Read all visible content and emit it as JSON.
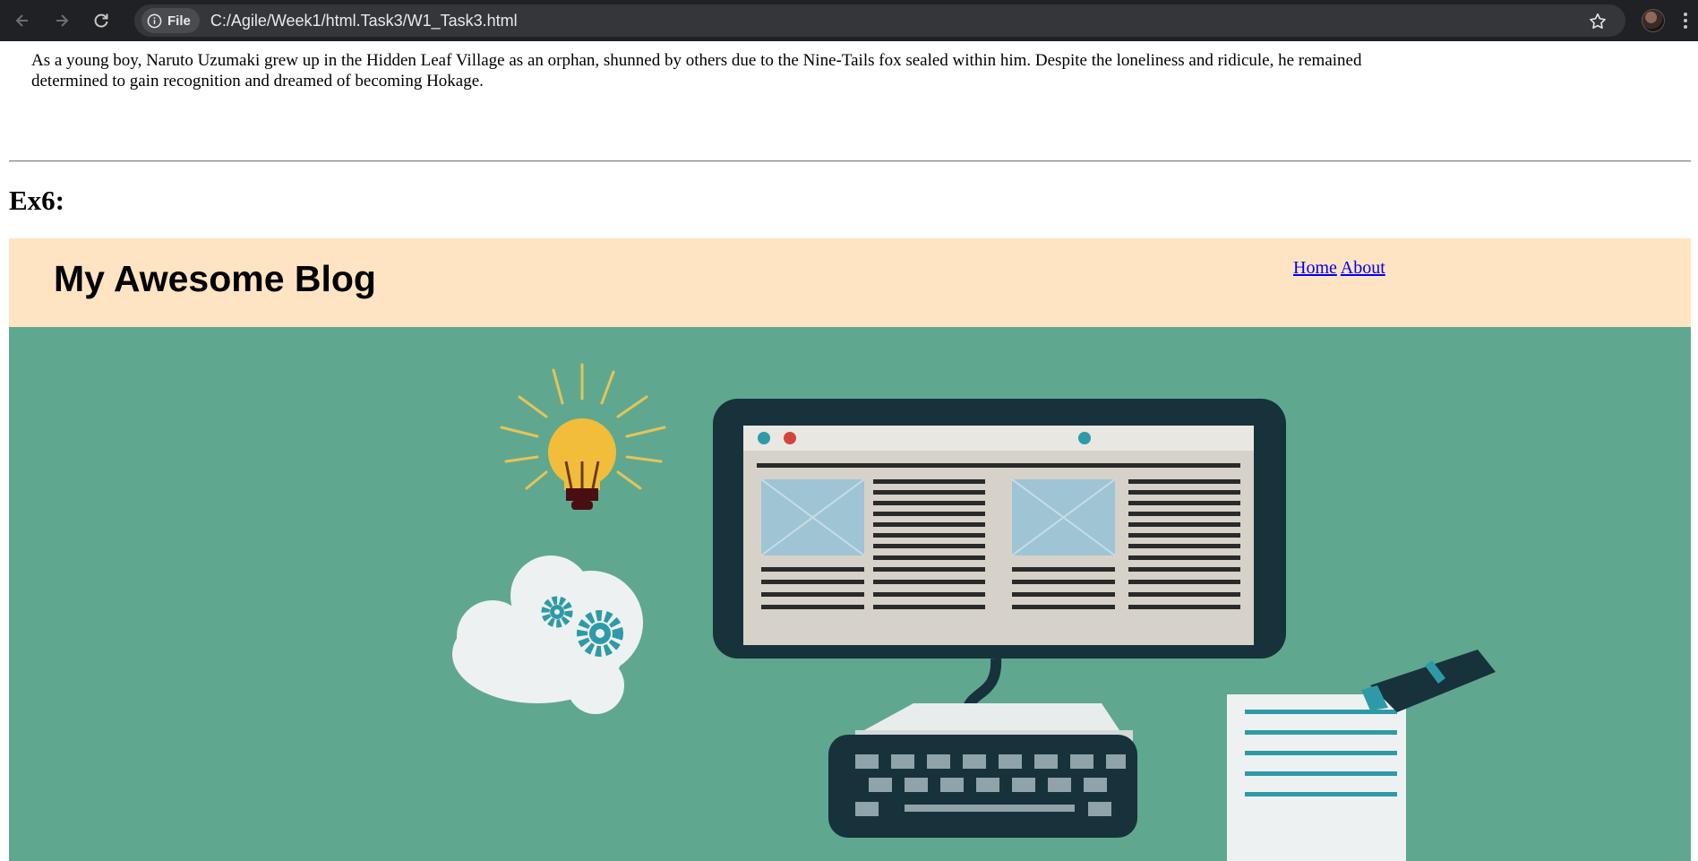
{
  "browser": {
    "url": "C:/Agile/Week1/html.Task3/W1_Task3.html",
    "site_chip_label": "File",
    "icons": [
      "back-arrow-icon",
      "forward-arrow-icon",
      "reload-icon",
      "info-icon",
      "star-icon",
      "profile-avatar",
      "more-menu-icon"
    ]
  },
  "page": {
    "story_text": "As a young boy, Naruto Uzumaki grew up in the Hidden Leaf Village as an orphan, shunned by others due to the Nine-Tails fox sealed within him. Despite the loneliness and ridicule, he remained determined to gain recognition and dreamed of becoming Hokage.",
    "section_heading": "Ex6:",
    "blog": {
      "title": "My Awesome Blog",
      "nav": [
        {
          "label": "Home"
        },
        {
          "label": "About"
        }
      ],
      "header_bg": "#ffe4c4",
      "hero_bg": "#5fa88f"
    }
  }
}
